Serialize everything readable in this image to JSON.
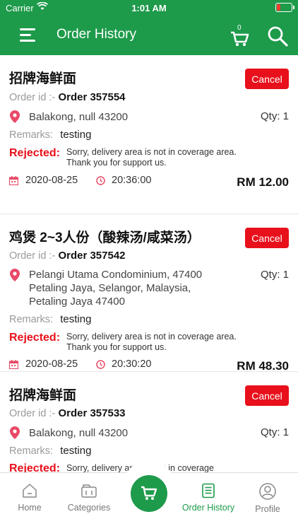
{
  "status_bar": {
    "carrier": "Carrier",
    "time": "1:01 AM"
  },
  "header": {
    "title": "Order History",
    "cart_count": "0"
  },
  "orders": [
    {
      "name": "招牌海鲜面",
      "cancel_label": "Cancel",
      "order_id_label": "Order id :-",
      "order_id": "Order 357554",
      "address": "Balakong, null 43200",
      "qty": "Qty: 1",
      "remarks_label": "Remarks:",
      "remarks": "testing",
      "rejected_label": "Rejected:",
      "rejected_text": "Sorry, delivery area is not in coverage area. Thank you for support us.",
      "date": "2020-08-25",
      "time": "20:36:00",
      "total": "RM 12.00"
    },
    {
      "name": "鸡煲 2~3人份（酸辣汤/咸菜汤）",
      "cancel_label": "Cancel",
      "order_id_label": "Order id :-",
      "order_id": "Order 357542",
      "address": "Pelangi Utama Condominium, 47400 Petaling Jaya, Selangor, Malaysia, Petaling Jaya 47400",
      "qty": "Qty: 1",
      "remarks_label": "Remarks:",
      "remarks": "testing",
      "rejected_label": "Rejected:",
      "rejected_text": "Sorry, delivery area is not in coverage area. Thank you for support us.",
      "date": "2020-08-25",
      "time": "20:30:20",
      "total": "RM 48.30"
    },
    {
      "name": "招牌海鲜面",
      "cancel_label": "Cancel",
      "order_id_label": "Order id :-",
      "order_id": "Order 357533",
      "address": "Balakong, null 43200",
      "qty": "Qty: 1",
      "remarks_label": "Remarks:",
      "remarks": "testing",
      "rejected_label": "Rejected:",
      "rejected_text": "Sorry, delivery area is not in coverage"
    }
  ],
  "tabs": [
    {
      "label": "Home",
      "icon": "home-icon"
    },
    {
      "label": "Categories",
      "icon": "categories-icon"
    },
    {
      "label": "Order History",
      "icon": "order-history-icon"
    },
    {
      "label": "Profile",
      "icon": "profile-icon"
    }
  ],
  "colors": {
    "primary": "#1d9a4a",
    "danger": "#e8101b",
    "background": "#e6e6e6"
  }
}
